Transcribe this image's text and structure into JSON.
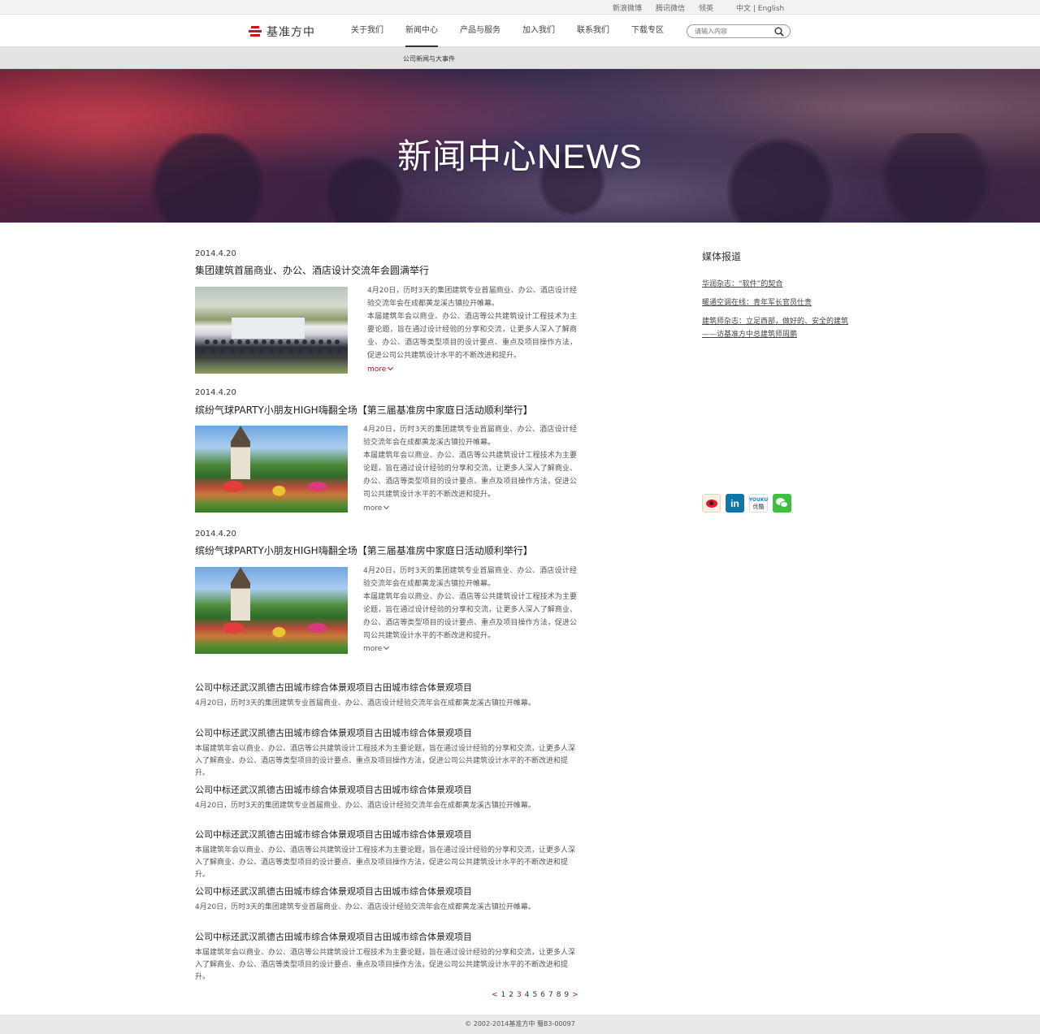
{
  "topbar": {
    "links": [
      "新浪微博",
      "腾讯微信",
      "领英"
    ],
    "lang": "中文 | English"
  },
  "header": {
    "logo_text": "基准方中",
    "nav": [
      "关于我们",
      "新闻中心",
      "产品与服务",
      "加入我们",
      "联系我们",
      "下载专区"
    ],
    "active_nav": "新闻中心",
    "search_placeholder": "请输入内容"
  },
  "subnav": {
    "item": "公司新闻与大事件"
  },
  "banner": {
    "title": "新闻中心NEWS"
  },
  "articles": [
    {
      "date": "2014.4.20",
      "title": "集团建筑首届商业、办公、酒店设计交流年会圆满举行",
      "lead": "4月20日，历时3天的集团建筑专业首届商业、办公、酒店设计经验交流年会在成都黄龙溪古镇拉开帷幕。",
      "body": "本届建筑年会以商业、办公、酒店等公共建筑设计工程技术为主要论题，旨在通过设计经验的分享和交流，让更多人深入了解商业、办公、酒店等类型项目的设计要点、重点及项目操作方法，促进公司公共建筑设计水平的不断改进和提升。",
      "more": "more"
    },
    {
      "date": "2014.4.20",
      "title": "缤纷气球PARTY小朋友HIGH嗨翻全场【第三届基准房中家庭日活动顺利举行】",
      "lead": "4月20日，历时3天的集团建筑专业首届商业、办公、酒店设计经验交流年会在成都黄龙溪古镇拉开帷幕。",
      "body": "本届建筑年会以商业、办公、酒店等公共建筑设计工程技术为主要论题，旨在通过设计经验的分享和交流，让更多人深入了解商业、办公、酒店等类型项目的设计要点、重点及项目操作方法，促进公司公共建筑设计水平的不断改进和提升。",
      "more": "more"
    },
    {
      "date": "2014.4.20",
      "title": "缤纷气球PARTY小朋友HIGH嗨翻全场【第三届基准房中家庭日活动顺利举行】",
      "lead": "4月20日，历时3天的集团建筑专业首届商业、办公、酒店设计经验交流年会在成都黄龙溪古镇拉开帷幕。",
      "body": "本届建筑年会以商业、办公、酒店等公共建筑设计工程技术为主要论题，旨在通过设计经验的分享和交流，让更多人深入了解商业、办公、酒店等类型项目的设计要点、重点及项目操作方法，促进公司公共建筑设计水平的不断改进和提升。",
      "more": "more"
    }
  ],
  "list": [
    {
      "title": "公司中标还武汉凯德古田城市综合体景观项目古田城市综合体景观项目",
      "desc": "4月20日，历时3天的集团建筑专业首届商业、办公、酒店设计经验交流年会在成都黄龙溪古镇拉开帷幕。"
    },
    {
      "title": "公司中标还武汉凯德古田城市综合体景观项目古田城市综合体景观项目",
      "desc": "本届建筑年会以商业、办公、酒店等公共建筑设计工程技术为主要论题，旨在通过设计经验的分享和交流，让更多人深入了解商业、办公、酒店等类型项目的设计要点、重点及项目操作方法，促进公司公共建筑设计水平的不断改进和提升。"
    },
    {
      "title": "公司中标还武汉凯德古田城市综合体景观项目古田城市综合体景观项目",
      "desc": "4月20日，历时3天的集团建筑专业首届商业、办公、酒店设计经验交流年会在成都黄龙溪古镇拉开帷幕。"
    },
    {
      "title": "公司中标还武汉凯德古田城市综合体景观项目古田城市综合体景观项目",
      "desc": "本届建筑年会以商业、办公、酒店等公共建筑设计工程技术为主要论题，旨在通过设计经验的分享和交流，让更多人深入了解商业、办公、酒店等类型项目的设计要点、重点及项目操作方法，促进公司公共建筑设计水平的不断改进和提升。"
    },
    {
      "title": "公司中标还武汉凯德古田城市综合体景观项目古田城市综合体景观项目",
      "desc": "4月20日，历时3天的集团建筑专业首届商业、办公、酒店设计经验交流年会在成都黄龙溪古镇拉开帷幕。"
    },
    {
      "title": "公司中标还武汉凯德古田城市综合体景观项目古田城市综合体景观项目",
      "desc": "本届建筑年会以商业、办公、酒店等公共建筑设计工程技术为主要论题，旨在通过设计经验的分享和交流，让更多人深入了解商业、办公、酒店等类型项目的设计要点、重点及项目操作方法，促进公司公共建筑设计水平的不断改进和提升。"
    }
  ],
  "pager": {
    "prev": "<",
    "pages": [
      "1",
      "2",
      "3",
      "4",
      "5",
      "6",
      "7",
      "8",
      "9"
    ],
    "current": "3",
    "next": ">"
  },
  "sidebar": {
    "title": "媒体报道",
    "links": [
      "华润杂志：“软件”的契合",
      "暖通空调在线：青年军长官员仕贵",
      "建筑师杂志：立足西部，做好的、安全的建筑——访基准方中总建筑师周鹏"
    ],
    "social": [
      "weibo-icon",
      "linkedin-icon",
      "youku-icon",
      "wechat-icon"
    ],
    "linkedin_text": "in",
    "youku_top": "YOUKU",
    "youku_bottom": "优酷"
  },
  "colors": {
    "accent": "#b3141c",
    "logo_red": "#c7161e"
  },
  "footer": {
    "text": "© 2002-2014基准方中 蜀B3-00097"
  }
}
